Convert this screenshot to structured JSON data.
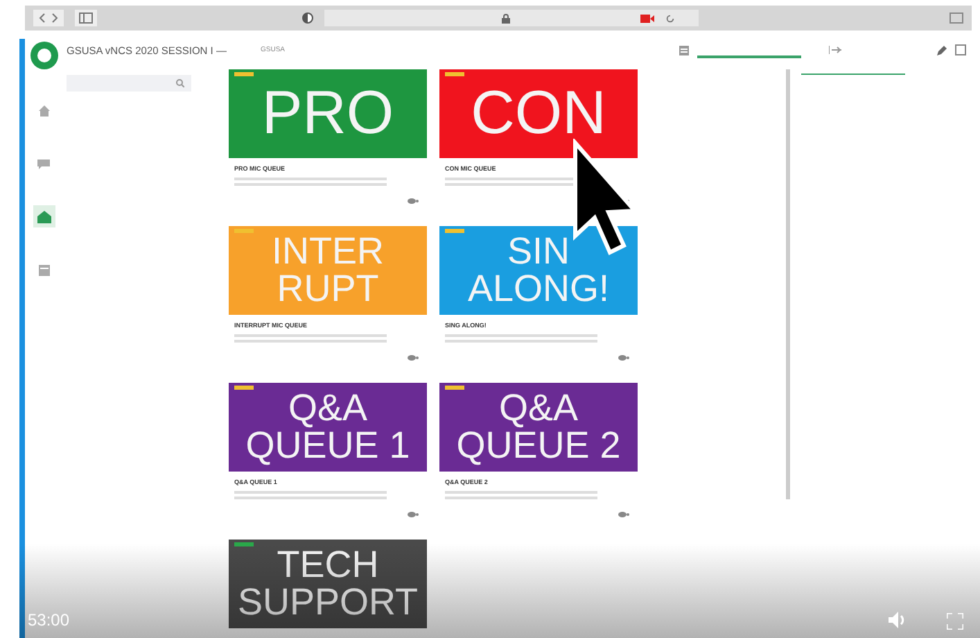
{
  "app": {
    "title": "GSUSA vNCS 2020 SESSION I —",
    "breadcrumb": "GSUSA",
    "sidebar_items": [
      {
        "kind": "home",
        "selected": false
      },
      {
        "kind": "chat",
        "selected": false
      },
      {
        "kind": "hall",
        "selected": true
      },
      {
        "kind": "schedule",
        "selected": false
      }
    ]
  },
  "cards": [
    {
      "label_lines": [
        "PRO"
      ],
      "color": "#1e9640",
      "tag": {
        "color": "#f0c030"
      },
      "title": "PRO MIC QUEUE"
    },
    {
      "label_lines": [
        "CON"
      ],
      "color": "#f0141e",
      "tag": {
        "color": "#f0c030"
      },
      "title": "CON MIC QUEUE"
    },
    {
      "label_lines": [
        "INTER",
        "RUPT"
      ],
      "color": "#f7a12b",
      "tag": {
        "color": "#f0c030"
      },
      "title": "INTERRUPT MIC QUEUE"
    },
    {
      "label_lines": [
        "SIN",
        "ALONG!"
      ],
      "color": "#1a9ee0",
      "tag": {
        "color": "#f0c030"
      },
      "title": "SING ALONG!"
    },
    {
      "label_lines": [
        "Q&A",
        "QUEUE 1"
      ],
      "color": "#6a2b94",
      "tag": {
        "color": "#f0c030"
      },
      "title": "Q&A QUEUE 1"
    },
    {
      "label_lines": [
        "Q&A",
        "QUEUE 2"
      ],
      "color": "#6a2b94",
      "tag": {
        "color": "#f0c030"
      },
      "title": "Q&A QUEUE 2"
    },
    {
      "label_lines": [
        "TECH",
        "SUPPORT"
      ],
      "color": "#4a4a4a",
      "tag": {
        "color": "#2aa84a"
      }
    }
  ],
  "video": {
    "time": "53:00"
  }
}
